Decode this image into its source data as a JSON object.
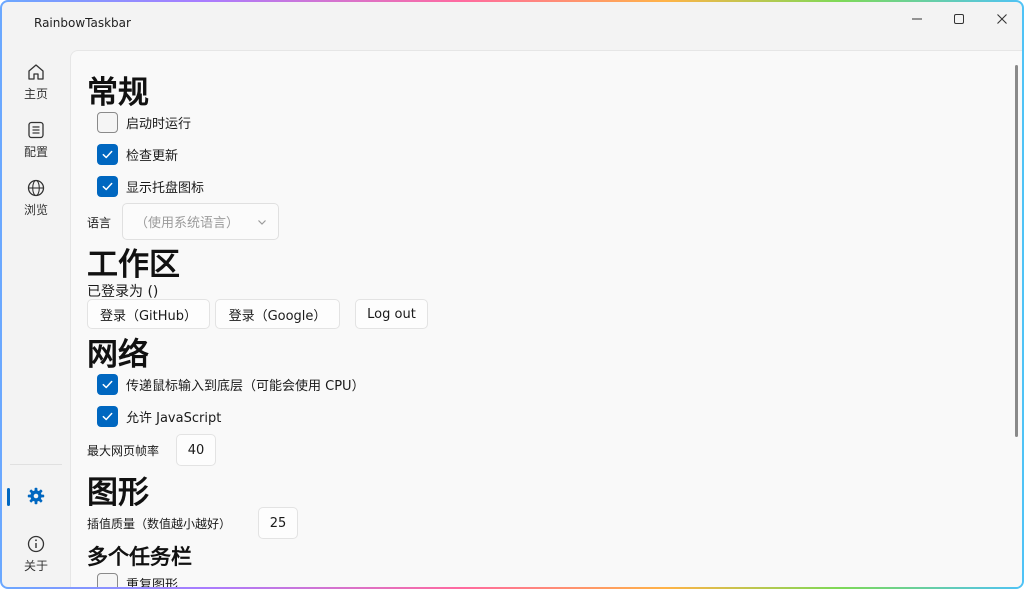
{
  "window": {
    "title": "RainbowTaskbar",
    "minimize_glyph": "—",
    "maximize_glyph": "☐",
    "close_glyph": "✕"
  },
  "nav": {
    "items": [
      {
        "label": "主页",
        "icon": "home-icon"
      },
      {
        "label": "配置",
        "icon": "list-icon"
      },
      {
        "label": "浏览",
        "icon": "globe-icon"
      }
    ],
    "settings": {
      "icon": "gear-icon",
      "active": true
    },
    "about": {
      "label": "关于",
      "icon": "info-icon"
    }
  },
  "general": {
    "title": "常规",
    "run_on_startup": {
      "label": "启动时运行",
      "checked": false
    },
    "check_updates": {
      "label": "检查更新",
      "checked": true
    },
    "show_tray_icon": {
      "label": "显示托盘图标",
      "checked": true
    },
    "language_label": "语言",
    "language_value": "（使用系统语言）"
  },
  "workspace": {
    "title": "工作区",
    "logged_in_as": "已登录为 ()",
    "login_github": "登录（GitHub）",
    "login_google": "登录（Google）",
    "logout": "Log out"
  },
  "network": {
    "title": "网络",
    "pass_mouse_input": {
      "label": "传递鼠标输入到底层（可能会使用 CPU）",
      "checked": true
    },
    "allow_javascript": {
      "label": "允许 JavaScript",
      "checked": true
    },
    "max_fps_label": "最大网页帧率",
    "max_fps_value": "40"
  },
  "graphics": {
    "title": "图形",
    "interp_quality_label": "插值质量（数值越小越好）",
    "interp_quality_value": "25"
  },
  "multi_taskbar": {
    "title": "多个任务栏",
    "repeat_graphics": {
      "label": "重复图形",
      "checked": false
    }
  },
  "colors": {
    "accent": "#0067c0"
  }
}
